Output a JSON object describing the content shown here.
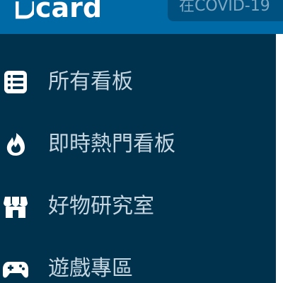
{
  "header": {
    "logo_text": "card",
    "search_placeholder": "在COVID-19"
  },
  "sidebar": {
    "items": [
      {
        "label": "所有看板",
        "icon": "board-list-icon"
      },
      {
        "label": "即時熱門看板",
        "icon": "flame-icon"
      },
      {
        "label": "好物研究室",
        "icon": "store-icon"
      },
      {
        "label": "遊戲專區",
        "icon": "gamepad-icon"
      }
    ]
  },
  "colors": {
    "header_bg": "#006aa6",
    "sidebar_bg": "#00324e",
    "label_text": "#c6d6e1",
    "search_bg": "#00517f"
  }
}
